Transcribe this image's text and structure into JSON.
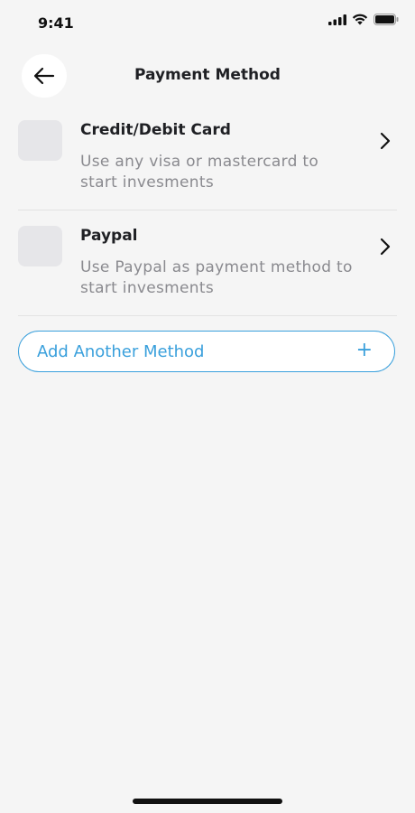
{
  "status_bar": {
    "time": "9:41"
  },
  "header": {
    "title": "Payment Method",
    "back_icon": "arrow-left-icon"
  },
  "methods": [
    {
      "title": "Credit/Debit Card",
      "description": "Use any visa or mastercard to start invesments"
    },
    {
      "title": "Paypal",
      "description": "Use Paypal as payment method to start invesments"
    }
  ],
  "add_method": {
    "label": "Add Another Method",
    "icon": "+"
  },
  "colors": {
    "accent": "#3aa0dc",
    "background": "#f5f5f5",
    "icon_placeholder": "#e6e6e9"
  }
}
